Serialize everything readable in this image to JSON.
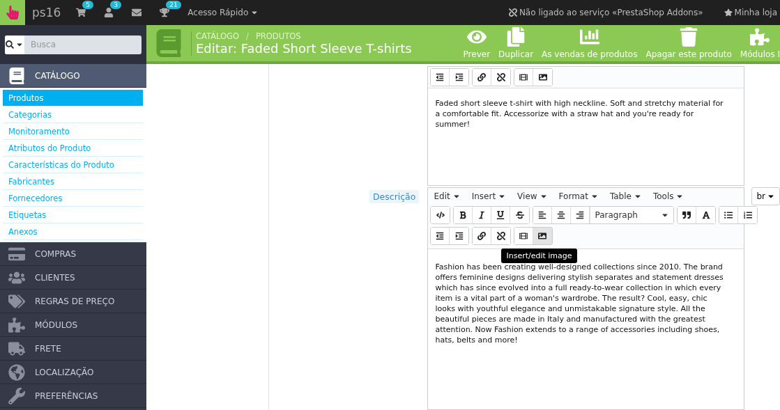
{
  "topbar": {
    "shop": "ps16",
    "badges": [
      {
        "kind": "cart",
        "count": "5"
      },
      {
        "kind": "user",
        "count": "3"
      },
      {
        "kind": "mail"
      },
      {
        "kind": "trophy",
        "count": "21"
      }
    ],
    "quick_access": "Acesso Rápido",
    "addons": "Não ligado ao serviço «PrestaShop Addons»",
    "my_shop": "Minha loja"
  },
  "search": {
    "placeholder": "Busca"
  },
  "sidebar": {
    "items": [
      {
        "kind": "catalog",
        "label": "CATÁLOGO",
        "expanded": true,
        "children": [
          {
            "label": "Produtos",
            "selected": true
          },
          {
            "label": "Categorias",
            "selected": false
          },
          {
            "label": "Monitoramento",
            "selected": false
          },
          {
            "label": "Atributos do Produto",
            "selected": false
          },
          {
            "label": "Características do Produto",
            "selected": false
          },
          {
            "label": "Fabricantes",
            "selected": false
          },
          {
            "label": "Fornecedores",
            "selected": false
          },
          {
            "label": "Etiquetas",
            "selected": false
          },
          {
            "label": "Anexos",
            "selected": false
          }
        ]
      },
      {
        "kind": "orders",
        "label": "COMPRAS",
        "expanded": false
      },
      {
        "kind": "customers",
        "label": "CLIENTES",
        "expanded": false
      },
      {
        "kind": "prices",
        "label": "REGRAS DE PREÇO",
        "expanded": false
      },
      {
        "kind": "modules",
        "label": "MÓDULOS",
        "expanded": false
      },
      {
        "kind": "shipping",
        "label": "FRETE",
        "expanded": false
      },
      {
        "kind": "localization",
        "label": "LOCALIZAÇÃO",
        "expanded": false
      },
      {
        "kind": "preferences",
        "label": "PREFERÊNCIAS",
        "expanded": false
      }
    ]
  },
  "page_header": {
    "breadcrumb": [
      "CATÁLOGO",
      "PRODUTOS"
    ],
    "breadcrumb_separator": "/",
    "title": "Editar: Faded Short Sleeve T-shirts",
    "actions": [
      {
        "kind": "preview",
        "label": "Prever"
      },
      {
        "kind": "duplicate",
        "label": "Duplicar"
      },
      {
        "kind": "sales",
        "label": "As vendas de produtos"
      },
      {
        "kind": "delete",
        "label": "Apagar este produto"
      },
      {
        "kind": "modules",
        "label": "Módulos I"
      }
    ]
  },
  "short_description": {
    "text": "Faded short sleeve t-shirt with high neckline. Soft and stretchy material for a comfortable fit. Accessorize with a straw hat and you're ready for summer!"
  },
  "description": {
    "label": "Descrição",
    "menus": [
      "Edit",
      "Insert",
      "View",
      "Format",
      "Table",
      "Tools"
    ],
    "block_format": "Paragraph",
    "tooltip": "Insert/edit image",
    "language": "br",
    "text": "Fashion has been creating well-designed collections since 2010. The brand offers feminine designs delivering stylish separates and statement dresses which has since evolved into a full ready-to-wear collection in which every item is a vital part of a woman's wardrobe. The result? Cool, easy, chic looks with youthful elegance and unmistakable signature style. All the beautiful pieces are made in Italy and manufactured with the greatest attention. Now Fashion extends to a range of accessories including shoes, hats, belts and more!"
  }
}
